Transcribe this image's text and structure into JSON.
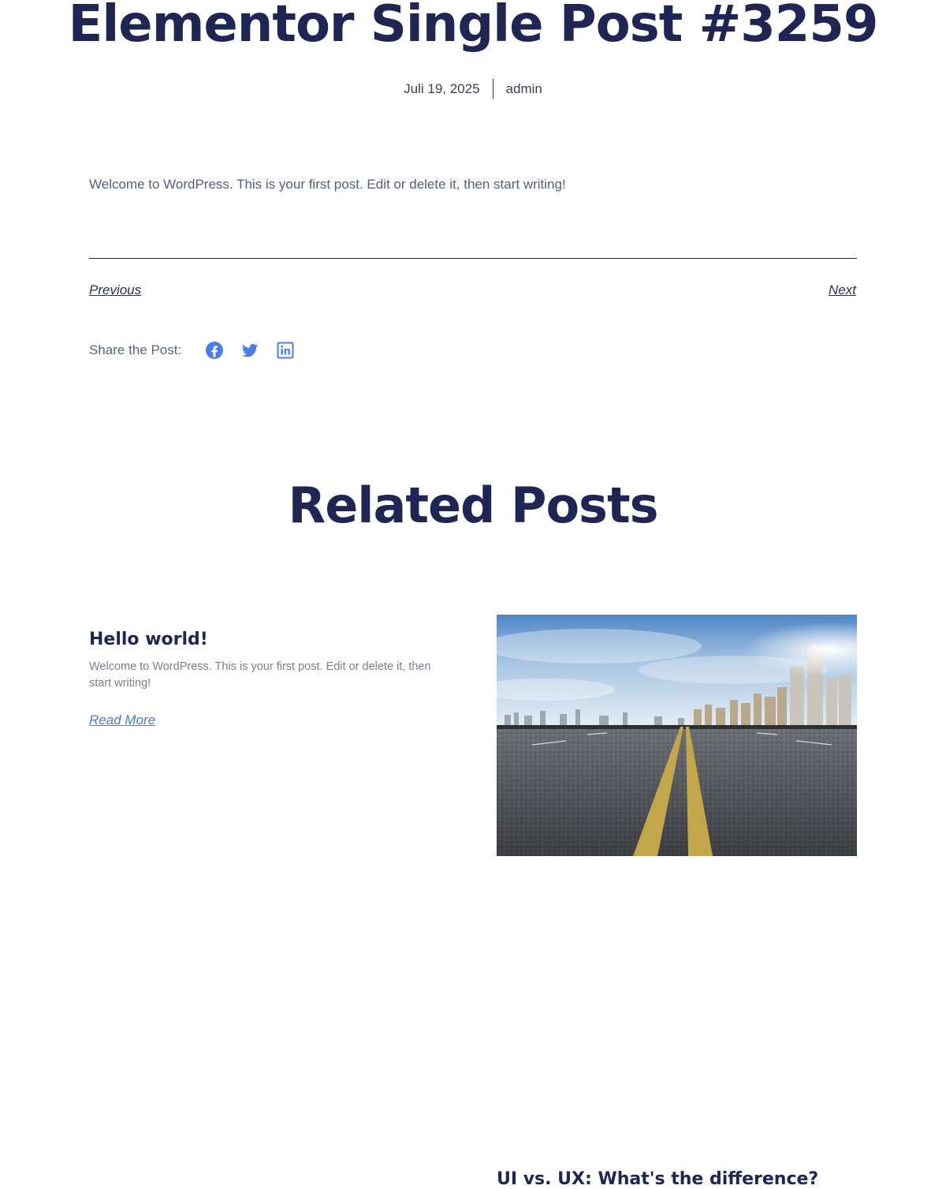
{
  "post": {
    "title": "Elementor Single Post #3259",
    "date": "Juli 19, 2025",
    "author": "admin",
    "content": "Welcome to WordPress. This is your first post. Edit or delete it, then start writing!"
  },
  "navigation": {
    "previous_label": "Previous",
    "next_label": "Next"
  },
  "share": {
    "label": "Share the Post:",
    "icons": [
      "facebook-icon",
      "twitter-icon",
      "linkedin-icon"
    ],
    "icon_color": "#4a7ee6"
  },
  "related": {
    "title": "Related Posts",
    "posts": [
      {
        "title": "Hello world!",
        "excerpt": "Welcome to WordPress. This is your first post. Edit or delete it, then start writing!",
        "read_more_label": "Read More",
        "image": "city-road-image"
      },
      {
        "title": "UI vs. UX: What's the difference?"
      }
    ]
  },
  "colors": {
    "heading": "#1f2654",
    "link": "#4a79d6",
    "body_text": "#54607c"
  }
}
